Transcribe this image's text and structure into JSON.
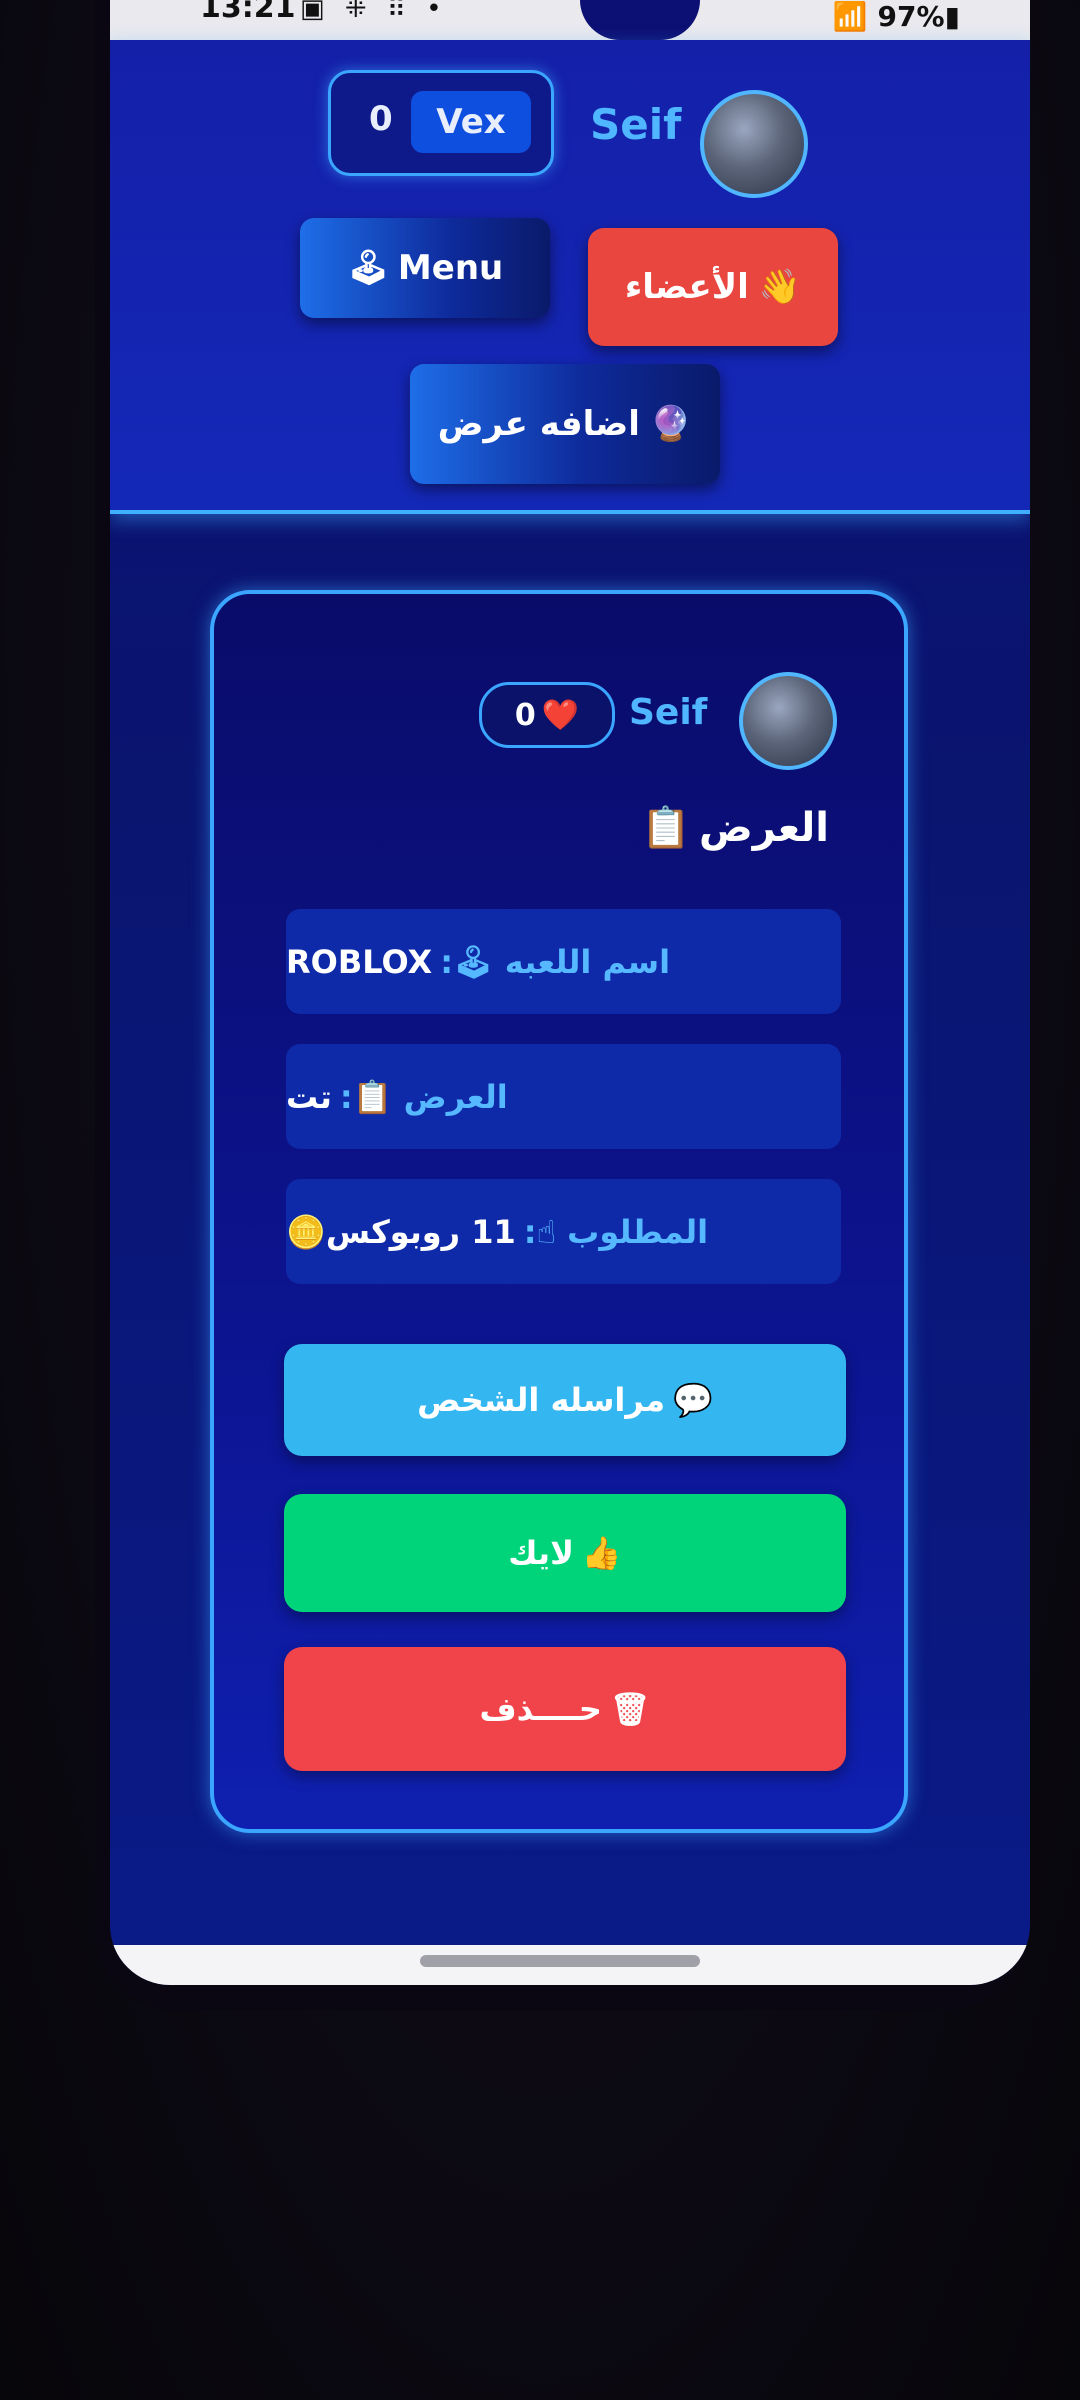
{
  "status_bar": {
    "time": "13:21",
    "left_icons": "▣ ⁜ ⠿ •",
    "battery": "97%"
  },
  "header": {
    "balance_value": "0",
    "balance_currency": "Vex",
    "username": "Seif",
    "menu_label": "Menu",
    "menu_icon": "🕹",
    "members_label": "الأعضاء",
    "members_icon": "👋",
    "add_offer_label": "اضافه عرض",
    "add_offer_icon": "🔮"
  },
  "card": {
    "username": "Seif",
    "likes": "0",
    "likes_icon": "❤️",
    "title": "العرض",
    "title_icon": "📋",
    "fields": [
      {
        "label": "اسم اللعبه 🕹:",
        "value": "ROBLOX"
      },
      {
        "label": "العرض 📋:",
        "value": "تت"
      },
      {
        "label": "المطلوب ☝:",
        "value": "11 روبوكس🪙"
      }
    ],
    "message_label": "مراسله الشخص",
    "message_icon": "💬",
    "like_label": "لايك",
    "like_icon": "👍",
    "delete_label": "حــــذف",
    "delete_icon": "🗑"
  },
  "colors": {
    "accent_blue": "#3aa6ff",
    "members_red": "#e8463f",
    "message_cyan": "#34b6f0",
    "like_green": "#00d47a",
    "delete_red": "#f0444a"
  }
}
